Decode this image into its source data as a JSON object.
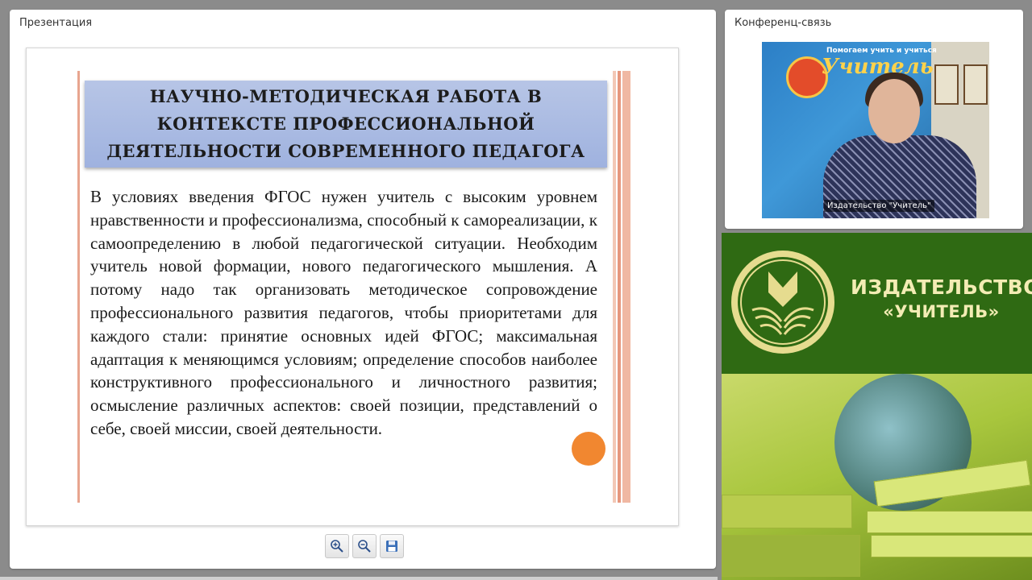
{
  "presentation": {
    "panel_title": "Презентация",
    "slide": {
      "title": "Научно-методическая работа в контексте профессиональной деятельности современного педагога",
      "body": "В условиях введения ФГОС нужен учитель с высоким уровнем нравственности и профессионализма, способный к самореализации, к самоопределению в любой педагогической ситуации. Необходим учитель новой формации, нового педагогического мышления. А потому надо так организовать методическое сопровождение профессионального развития педагогов, чтобы приоритетами для каждого стали: принятие основных идей ФГОС; максимальная адаптация к меняющимся условиям; определение способов наиболее конструктивного профессионального и личностного развития; осмысление различных аспектов: своей позиции, представлений о себе, своей миссии, своей деятельности."
    },
    "toolbar": {
      "zoom_in_icon": "zoom-in-icon",
      "zoom_out_icon": "zoom-out-icon",
      "save_icon": "floppy-disk-icon"
    }
  },
  "conference": {
    "panel_title": "Конференц-связь",
    "video": {
      "caption": "Издательство \"Учитель\"",
      "banner_top_text": "Помогаем учить и учиться",
      "banner_brand": "Учитель"
    }
  },
  "publisher_banner": {
    "line1": "ИЗДАТЕЛЬСТВО",
    "line2": "«УЧИТЕЛЬ»"
  },
  "colors": {
    "slide_title_bg": "#a9bbe2",
    "banner_green": "#2f6a13",
    "banner_text": "#f3ecb4",
    "pointer": "#f07a1a"
  }
}
